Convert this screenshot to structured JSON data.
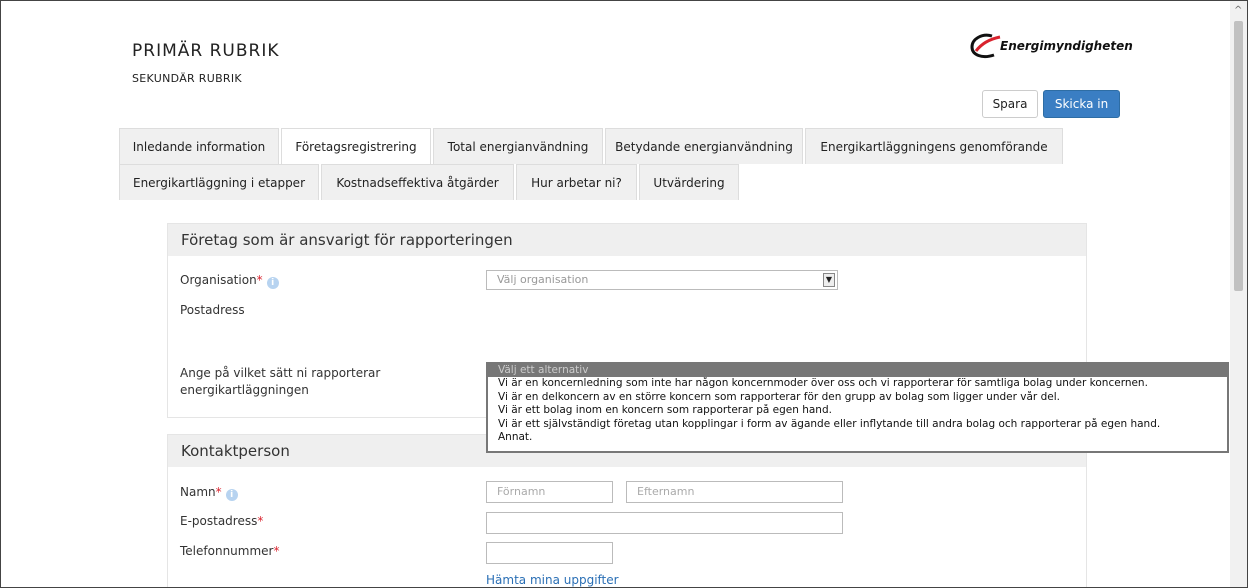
{
  "header": {
    "title": "PRIMÄR RUBRIK",
    "subtitle": "SEKUNDÄR RUBRIK",
    "logo_text": "Energimyndigheten"
  },
  "actions": {
    "save": "Spara",
    "submit": "Skicka in"
  },
  "tabs_row1": [
    {
      "label": "Inledande information"
    },
    {
      "label": "Företagsregistrering"
    },
    {
      "label": "Total energianvändning"
    },
    {
      "label": "Betydande energianvändning"
    },
    {
      "label": "Energikartläggningens genomförande"
    }
  ],
  "tabs_row2": [
    {
      "label": "Energikartläggning i etapper"
    },
    {
      "label": "Kostnadseffektiva åtgärder"
    },
    {
      "label": "Hur arbetar ni?"
    },
    {
      "label": "Utvärdering"
    }
  ],
  "company_section": {
    "title": "Företag som är ansvarigt för rapporteringen",
    "organisation_label": "Organisation",
    "required_mark": "*",
    "organisation_placeholder": "Välj organisation",
    "postal_label": "Postadress",
    "reporting_label_line1": "Ange på vilket sätt ni rapporterar",
    "reporting_label_line2": "energikartläggningen",
    "reporting_options": [
      "Välj ett alternativ",
      "Vi är en koncernledning som inte har någon koncernmoder över oss och vi rapporterar för samtliga bolag under koncernen.",
      "Vi är en delkoncern av en större koncern som rapporterar för den grupp av bolag som ligger under vår del.",
      "Vi är ett bolag inom en koncern som rapporterar på egen hand.",
      "Vi är ett självständigt företag utan kopplingar i form av ägande eller inflytande till andra bolag och rapporterar på egen hand.",
      "Annat."
    ]
  },
  "contact_section": {
    "title": "Kontaktperson",
    "name_label": "Namn",
    "first_name_placeholder": "Förnamn",
    "last_name_placeholder": "Efternamn",
    "email_label": "E-postadress",
    "phone_label": "Telefonnummer",
    "fetch_link": "Hämta mina uppgifter"
  }
}
